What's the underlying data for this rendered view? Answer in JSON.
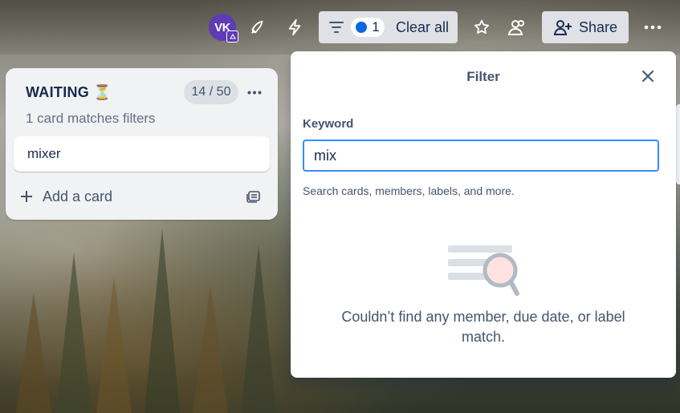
{
  "topbar": {
    "avatar_initials": "VK",
    "filter_count": "1",
    "clear_all_label": "Clear all",
    "share_label": "Share"
  },
  "list": {
    "title": "WAITING ⏳",
    "count": "14 / 50",
    "subtitle": "1 card matches filters",
    "cards": [
      {
        "title": "mixer"
      }
    ],
    "add_card_label": "Add a card"
  },
  "filter_panel": {
    "title": "Filter",
    "keyword_label": "Keyword",
    "keyword_value": "mix",
    "keyword_help": "Search cards, members, labels, and more.",
    "empty_message": "Couldn’t find any member, due date, or label match."
  },
  "colors": {
    "accent_blue": "#0c66e4",
    "focus_border": "#388bff",
    "avatar_bg": "#5f3bb5"
  }
}
